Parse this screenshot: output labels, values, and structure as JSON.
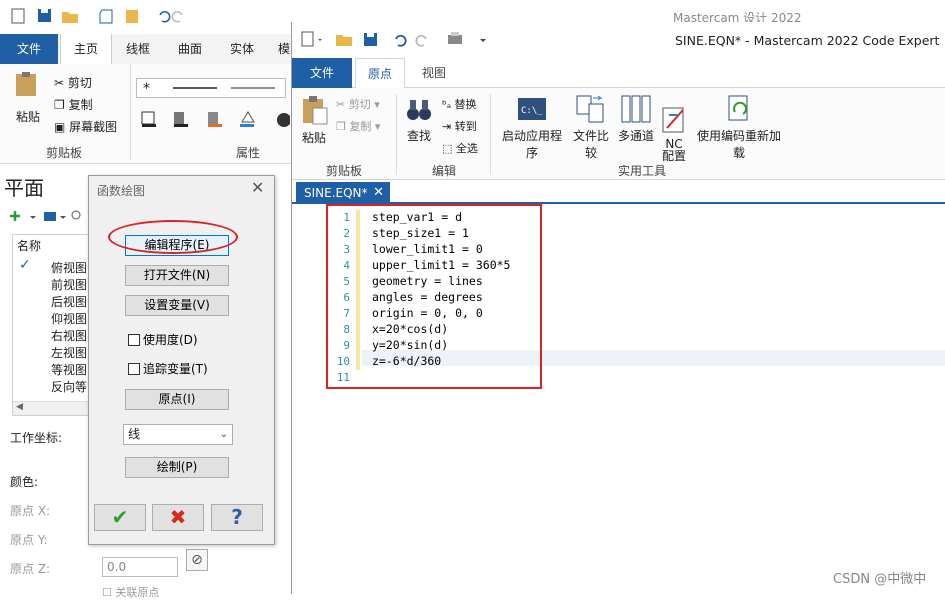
{
  "background": {
    "app_title": "Mastercam 设计 2022",
    "tabs": [
      "文件",
      "主页",
      "线框",
      "曲面",
      "实体",
      "模"
    ],
    "clipboard": {
      "paste": "粘贴",
      "cut": "剪切",
      "copy": "复制",
      "screenshot": "屏幕截图",
      "group": "剪贴板"
    },
    "attributes_group": "属性",
    "panel_title": "平面",
    "list_header": "名称",
    "planes": [
      "俯视图",
      "前视图",
      "后视图",
      "仰视图",
      "右视图",
      "左视图",
      "等视图",
      "反向等"
    ],
    "wcs_label": "工作坐标:",
    "color_label": "颜色:",
    "origin_x": "原点 X:",
    "origin_y": "原点 Y:",
    "origin_z": "原点 Z:",
    "origin_z_value": "0.0",
    "link_origin": "关联原点"
  },
  "dialog": {
    "title": "函数绘图",
    "edit_program": "编辑程序(E)",
    "open_file": "打开文件(N)",
    "set_variables": "设置变量(V)",
    "use_degrees": "使用度(D)",
    "trace_variables": "追踪变量(T)",
    "origin": "原点(I)",
    "geometry_type": "线",
    "draw": "绘制(P)"
  },
  "code_expert": {
    "title": "SINE.EQN* - Mastercam 2022 Code Expert",
    "tabs": {
      "file": "文件",
      "origin": "原点",
      "view": "视图"
    },
    "ribbon": {
      "paste": "粘贴",
      "cut": "剪切",
      "copy": "复制",
      "clipboard_group": "剪贴板",
      "find": "查找",
      "replace": "替换",
      "goto": "转到",
      "select_all": "全选",
      "edit_group": "编辑",
      "launch_app": "启动应用程序",
      "file_compare": "文件比较",
      "multi_channel": "多通道",
      "nc_config": "NC\n配置",
      "reload_encoding": "使用编码重新加载",
      "tools_group": "实用工具"
    },
    "document_tab": "SINE.EQN*",
    "code_lines": [
      "step_var1 = d",
      "step_size1 = 1",
      "lower_limit1 = 0",
      "upper_limit1 = 360*5",
      "geometry = lines",
      "angles = degrees",
      "origin = 0, 0, 0",
      "x=20*cos(d)",
      "y=20*sin(d)",
      "z=-6*d/360",
      ""
    ]
  },
  "watermark": "CSDN @中微中",
  "colors": {
    "accent": "#1f5fa6",
    "annotation": "#dd2222",
    "line_number": "#2b91af"
  }
}
